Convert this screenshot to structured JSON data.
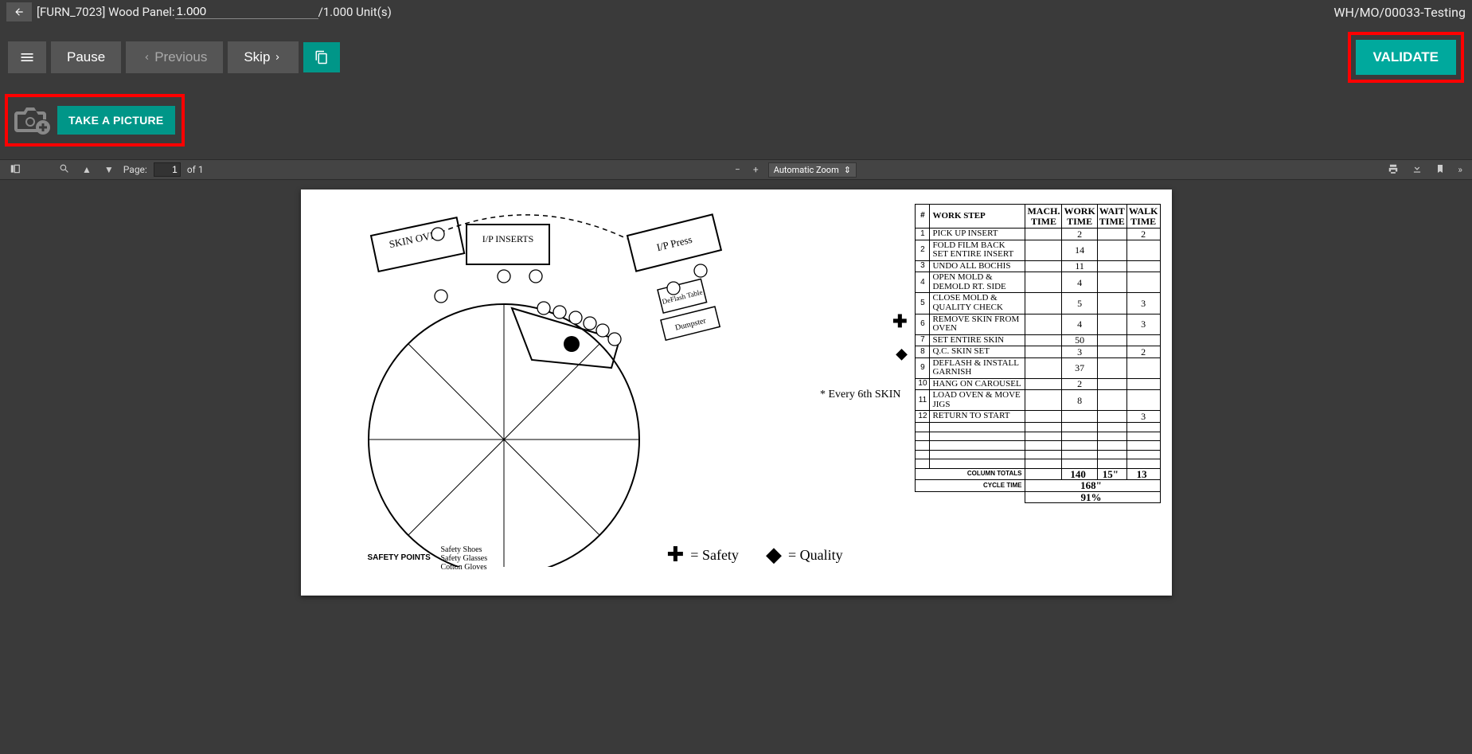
{
  "header": {
    "title_prefix": "[FURN_7023] Wood Panel: ",
    "qty_value": "1.000",
    "units_suffix": "/1.000 Unit(s)",
    "right_label": "WH/MO/00033-Testing"
  },
  "toolbar": {
    "pause": "Pause",
    "previous": "Previous",
    "skip": "Skip",
    "validate": "VALIDATE"
  },
  "picture": {
    "take_label": "TAKE A PICTURE"
  },
  "pdfbar": {
    "page_label": "Page:",
    "page_current": "1",
    "page_total_prefix": "of ",
    "page_total": "1",
    "zoom_label": "Automatic Zoom"
  },
  "document": {
    "note_every6th": "* Every 6th SKIN",
    "table": {
      "headers": {
        "num": "#",
        "workstep": "WORK STEP",
        "mach": "MACH. TIME",
        "work": "WORK TIME",
        "wait": "WAIT TIME",
        "walk": "WALK TIME"
      },
      "rows": [
        {
          "n": "1",
          "desc": "Pick up INSERT",
          "mach": "",
          "work": "2",
          "wait": "",
          "walk": "2"
        },
        {
          "n": "2",
          "desc": "Fold Film Back Set Entire Insert",
          "mach": "",
          "work": "14",
          "wait": "",
          "walk": ""
        },
        {
          "n": "3",
          "desc": "Undo All Bochis",
          "mach": "",
          "work": "11",
          "wait": "",
          "walk": ""
        },
        {
          "n": "4",
          "desc": "Open Mold & Demold Rt. Side",
          "mach": "",
          "work": "4",
          "wait": "",
          "walk": ""
        },
        {
          "n": "5",
          "desc": "Close Mold & Quality Check",
          "mach": "",
          "work": "5",
          "wait": "",
          "walk": "3",
          "marker": "plus"
        },
        {
          "n": "6",
          "desc": "Remove Skin From Oven",
          "mach": "",
          "work": "4",
          "wait": "",
          "walk": "3"
        },
        {
          "n": "7",
          "desc": "Set Entire Skin",
          "mach": "",
          "work": "50",
          "wait": "",
          "walk": "",
          "marker": "diamond"
        },
        {
          "n": "8",
          "desc": "Q.C. Skin Set",
          "mach": "",
          "work": "3",
          "wait": "",
          "walk": "2"
        },
        {
          "n": "9",
          "desc": "Deflash & Install Garnish",
          "mach": "",
          "work": "37",
          "wait": "",
          "walk": ""
        },
        {
          "n": "10",
          "desc": "Hang on Carousel",
          "mach": "",
          "work": "2",
          "wait": "",
          "walk": ""
        },
        {
          "n": "11",
          "desc": "Load Oven & Move Jigs",
          "mach": "",
          "work": "8",
          "wait": "",
          "walk": ""
        },
        {
          "n": "12",
          "desc": "Return to Start",
          "mach": "",
          "work": "",
          "wait": "",
          "walk": "3"
        }
      ],
      "blank_rows": 5,
      "totals": {
        "label": "COLUMN TOTALS",
        "mach": "",
        "work": "140",
        "wait": "15\"",
        "walk": "13"
      },
      "cycle": {
        "label": "CYCLE TIME",
        "value": "168\"",
        "pct": "91%"
      }
    },
    "safety_points_label": "SAFETY POINTS",
    "safety_items": [
      "Safety Shoes",
      "Safety Glasses",
      "Cotton Gloves"
    ],
    "legend_safety": "= Safety",
    "legend_quality": "= Quality",
    "diagram_labels": {
      "skin_oven": "SKIN OVEN",
      "ip_inserts": "I/P INSERTS",
      "ip_press": "I/P Press",
      "deflash": "DeFlash Table",
      "dumpster": "Dumpster"
    }
  }
}
